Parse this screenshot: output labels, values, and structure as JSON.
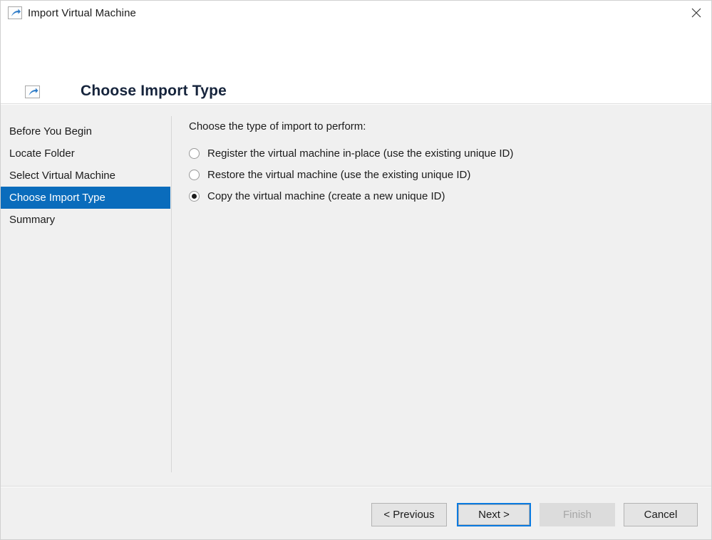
{
  "window": {
    "title": "Import Virtual Machine",
    "title_icon": "import-arrow-icon",
    "close_icon": "close-icon"
  },
  "header": {
    "title": "Choose Import Type",
    "icon": "import-arrow-icon"
  },
  "sidebar": {
    "items": [
      {
        "label": "Before You Begin",
        "selected": false
      },
      {
        "label": "Locate Folder",
        "selected": false
      },
      {
        "label": "Select Virtual Machine",
        "selected": false
      },
      {
        "label": "Choose Import Type",
        "selected": true
      },
      {
        "label": "Summary",
        "selected": false
      }
    ]
  },
  "main": {
    "prompt": "Choose the type of import to perform:",
    "options": [
      {
        "label": "Register the virtual machine in-place (use the existing unique ID)",
        "checked": false
      },
      {
        "label": "Restore the virtual machine (use the existing unique ID)",
        "checked": false
      },
      {
        "label": "Copy the virtual machine (create a new unique ID)",
        "checked": true
      }
    ]
  },
  "footer": {
    "previous_label": "< Previous",
    "next_label": "Next >",
    "finish_label": "Finish",
    "cancel_label": "Cancel",
    "finish_disabled": true,
    "next_focused": true
  },
  "colors": {
    "selection_blue": "#0a6cbc",
    "focus_blue": "#0a7ae0",
    "body_gray": "#f0f0f0",
    "title_navy": "#16243c",
    "icon_blue": "#2f7cc8"
  }
}
